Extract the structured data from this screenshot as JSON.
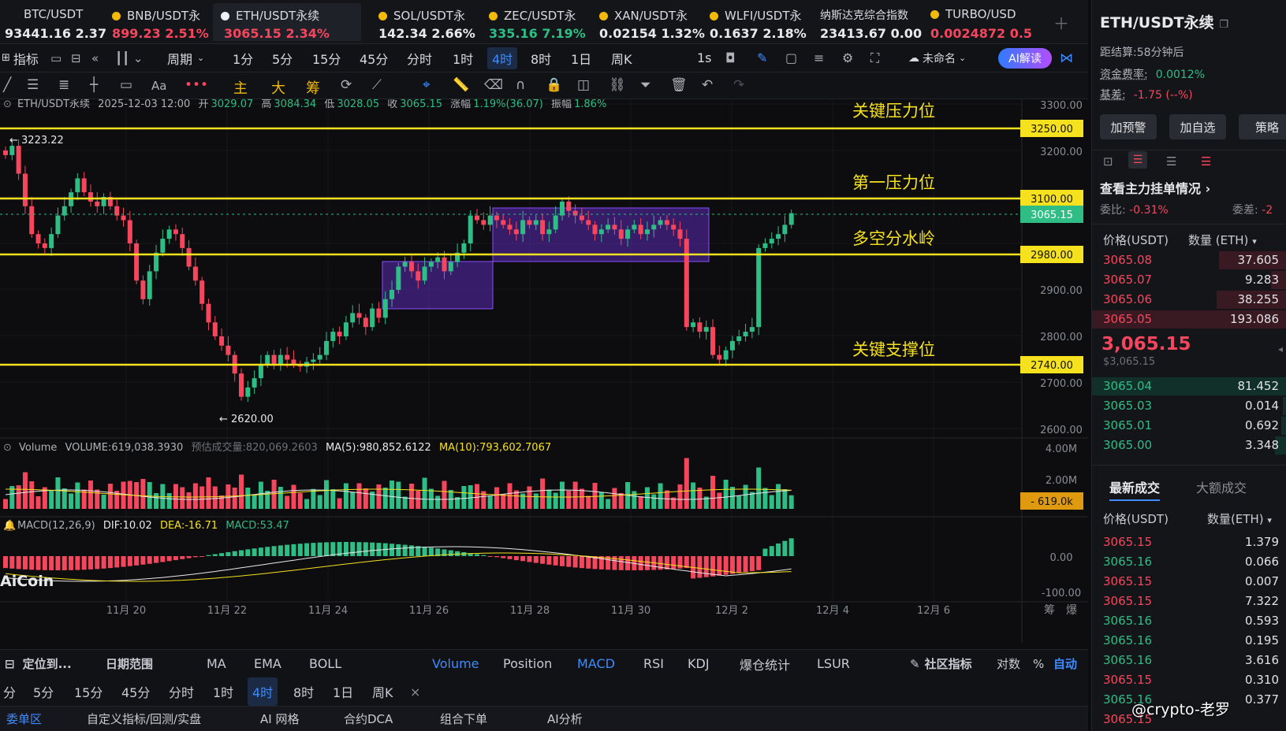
{
  "tickers": [
    {
      "name": "BTC/USDT",
      "price": "93441.16",
      "change": "2.37",
      "dir": "white"
    },
    {
      "name": "BNB/USDT永",
      "price": "899.23",
      "change": "2.51%",
      "dir": "down"
    },
    {
      "name": "ETH/USDT永续",
      "price": "3065.15",
      "change": "2.34%",
      "dir": "down"
    },
    {
      "name": "SOL/USDT永",
      "price": "142.34",
      "change": "2.66%",
      "dir": "white"
    },
    {
      "name": "ZEC/USDT永",
      "price": "335.16",
      "change": "7.19%",
      "dir": "up"
    },
    {
      "name": "XAN/USDT永",
      "price": "0.02154",
      "change": "1.32%",
      "dir": "white"
    },
    {
      "name": "WLFI/USDT永",
      "price": "0.1637",
      "change": "2.18%",
      "dir": "white"
    },
    {
      "name": "纳斯达克综合指数",
      "price": "23413.67",
      "change": "0.00",
      "dir": "white"
    },
    {
      "name": "TURBO/USD",
      "price": "0.0024872",
      "change": "0.5",
      "dir": "down"
    }
  ],
  "toolbar": {
    "indicator": "指标",
    "period": "周期",
    "intervals": [
      "1分",
      "5分",
      "15分",
      "45分",
      "分时",
      "1时",
      "4时",
      "8时",
      "1日",
      "周K"
    ],
    "selected_interval": "4时",
    "one_sec": "1s",
    "unnamed": "未命名",
    "ai_read": "AI解读",
    "draw_labels": [
      "主",
      "大",
      "筹"
    ]
  },
  "chart": {
    "info": {
      "symbol": "ETH/USDT永续",
      "datetime": "2025-12-03 12:00",
      "open_label": "开",
      "open": "3029.07",
      "high_label": "高",
      "high": "3084.34",
      "low_label": "低",
      "low": "3028.05",
      "close_label": "收",
      "close": "3065.15",
      "change_label": "涨幅",
      "change": "1.19%(36.07)",
      "amp_label": "振幅",
      "amp": "1.86%"
    },
    "levels": [
      {
        "label": "关键压力位",
        "price": "3250.00"
      },
      {
        "label": "第一压力位",
        "price": "3100.00"
      },
      {
        "label": "多空分水岭",
        "price": "2980.00"
      },
      {
        "label": "关键支撑位",
        "price": "2740.00"
      }
    ],
    "current_price": "3065.15",
    "price_ticks": [
      "3300.00",
      "3200.00",
      "2900.00",
      "2800.00",
      "2700.00",
      "2600.00"
    ],
    "high_marker": "3223.22",
    "low_marker": "2620.00",
    "date_ticks": [
      "11月 20",
      "11月 22",
      "11月 24",
      "11月 26",
      "11月 28",
      "11月 30",
      "12月 2",
      "12月 4",
      "12月 6"
    ],
    "volume": {
      "label": "Volume",
      "value": "VOLUME:619,038.3930",
      "est": "预估成交量:820,069.2603",
      "ma5": "MA(5):980,852.6122",
      "ma10": "MA(10):793,602.7067",
      "ticks": [
        "4.00M",
        "2.00M"
      ],
      "current": "619.0k"
    },
    "macd": {
      "label": "MACD(12,26,9)",
      "dif": "DIF:10.02",
      "dea": "DEA:-16.71",
      "macd": "MACD:53.47",
      "ticks": [
        "0.00",
        "-100.00"
      ]
    },
    "watermark": "AiCoin",
    "corner_labels": [
      "筹",
      "爆"
    ]
  },
  "bar3": {
    "locate": "定位到...",
    "date_range": "日期范围",
    "items": [
      "MA",
      "EMA",
      "BOLL",
      "Volume",
      "Position",
      "MACD",
      "RSI",
      "KDJ",
      "爆仓统计",
      "LSUR"
    ],
    "community": "社区指标",
    "log": "对数",
    "pct": "%",
    "auto": "自动"
  },
  "bar4": {
    "items": [
      "分",
      "5分",
      "15分",
      "45分",
      "分时",
      "1时",
      "4时",
      "8时",
      "1日",
      "周K"
    ],
    "selected": "4时",
    "close": "×"
  },
  "bar5": {
    "items": [
      "委单区",
      "自定义指标/回测/实盘",
      "AI 网格",
      "合约DCA",
      "组合下单",
      "AI分析"
    ]
  },
  "right": {
    "title": "ETH/USDT永续",
    "settle_label": "距结算:",
    "settle": "58分钟后",
    "funding_label": "资金费率:",
    "funding": "0.0012%",
    "basis_label": "基差:",
    "basis": "-1.75 (--%)",
    "buttons": [
      "加预警",
      "加自选",
      "策略"
    ],
    "main_orders": "查看主力挂单情况",
    "ratio_label": "委比:",
    "ratio": "-0.31%",
    "diff_label": "委差:",
    "diff": "-2",
    "col_price": "价格(USDT)",
    "col_qty": "数量 (ETH)",
    "asks": [
      {
        "price": "3065.08",
        "qty": "37.605"
      },
      {
        "price": "3065.07",
        "qty": "9.283"
      },
      {
        "price": "3065.06",
        "qty": "38.255"
      },
      {
        "price": "3065.05",
        "qty": "193.086"
      }
    ],
    "last_price": "3,065.15",
    "last_usd": "$3,065.15",
    "bids": [
      {
        "price": "3065.04",
        "qty": "81.452"
      },
      {
        "price": "3065.03",
        "qty": "0.014"
      },
      {
        "price": "3065.01",
        "qty": "0.692"
      },
      {
        "price": "3065.00",
        "qty": "3.348"
      }
    ],
    "trades_tab": "最新成交",
    "big_trades_tab": "大额成交",
    "col_price2": "价格(USDT)",
    "col_qty2": "数量(ETH)",
    "trades": [
      {
        "price": "3065.15",
        "qty": "1.379",
        "side": "down"
      },
      {
        "price": "3065.16",
        "qty": "0.066",
        "side": "up"
      },
      {
        "price": "3065.15",
        "qty": "0.007",
        "side": "down"
      },
      {
        "price": "3065.15",
        "qty": "7.322",
        "side": "down"
      },
      {
        "price": "3065.16",
        "qty": "0.593",
        "side": "up"
      },
      {
        "price": "3065.16",
        "qty": "0.195",
        "side": "up"
      },
      {
        "price": "3065.16",
        "qty": "3.616",
        "side": "up"
      },
      {
        "price": "3065.15",
        "qty": "0.310",
        "side": "down"
      },
      {
        "price": "3065.16",
        "qty": "0.377",
        "side": "up"
      },
      {
        "price": "3065.15",
        "qty": "",
        "side": "down"
      }
    ],
    "watermark": "@crypto-老罗"
  },
  "colors": {
    "up": "#2ebd85",
    "down": "#f6465d",
    "level": "#f5e11e",
    "zone": "#6a2cc9",
    "accent": "#3d8bff"
  }
}
